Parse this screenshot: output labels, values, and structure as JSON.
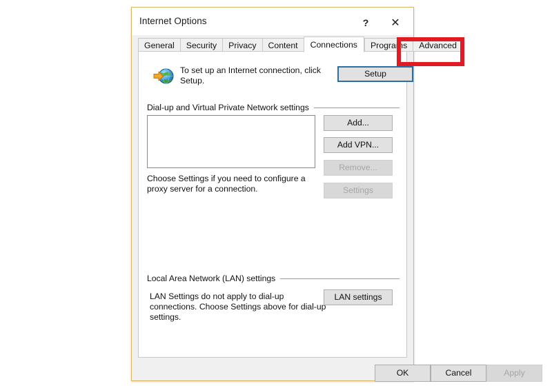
{
  "window": {
    "title": "Internet Options",
    "help_label": "?",
    "close_label": "✕"
  },
  "tabs": [
    {
      "label": "General",
      "active": false
    },
    {
      "label": "Security",
      "active": false
    },
    {
      "label": "Privacy",
      "active": false
    },
    {
      "label": "Content",
      "active": false
    },
    {
      "label": "Connections",
      "active": true
    },
    {
      "label": "Programs",
      "active": false
    },
    {
      "label": "Advanced",
      "active": false
    }
  ],
  "connections": {
    "setup": {
      "icon": "globe-with-arrow-icon",
      "description": "To set up an Internet connection, click Setup.",
      "button_label": "Setup"
    },
    "dialup_group": {
      "label": "Dial-up and Virtual Private Network settings",
      "list_items": [],
      "buttons": [
        {
          "label": "Add...",
          "disabled": false
        },
        {
          "label": "Add VPN...",
          "disabled": false
        },
        {
          "label": "Remove...",
          "disabled": true
        },
        {
          "label": "Settings",
          "disabled": true
        }
      ],
      "proxy_note": "Choose Settings if you need to configure a proxy server for a connection."
    },
    "lan_group": {
      "label": "Local Area Network (LAN) settings",
      "description": "LAN Settings do not apply to dial-up connections. Choose Settings above for dial-up settings.",
      "button_label": "LAN settings"
    }
  },
  "footer": {
    "ok_label": "OK",
    "cancel_label": "Cancel",
    "apply_label": "Apply",
    "apply_disabled": true
  },
  "annotation": {
    "type": "highlight-rectangle",
    "target": "Connections",
    "color": "#e01b24"
  }
}
